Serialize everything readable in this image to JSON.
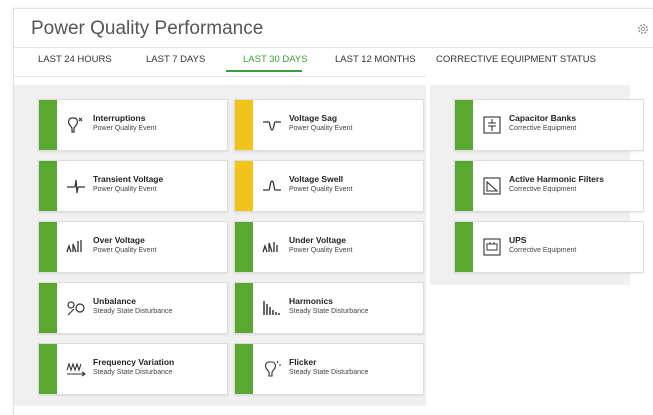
{
  "header": {
    "title": "Power Quality Performance",
    "settings_icon": "gear-icon"
  },
  "tabs": [
    {
      "label": "LAST 24 HOURS",
      "active": false
    },
    {
      "label": "LAST 7 DAYS",
      "active": false
    },
    {
      "label": "LAST 30 DAYS",
      "active": true
    },
    {
      "label": "LAST 12 MONTHS",
      "active": false
    }
  ],
  "right_tab": {
    "label": "CORRECTIVE EQUIPMENT STATUS"
  },
  "colors": {
    "green": "#5aa832",
    "yellow": "#f0c419",
    "accent": "#3d9a3d"
  },
  "events": [
    {
      "title": "Interruptions",
      "subtitle": "Power Quality Event",
      "status": "green",
      "icon": "interruption-icon"
    },
    {
      "title": "Voltage Sag",
      "subtitle": "Power Quality Event",
      "status": "yellow",
      "icon": "voltage-sag-icon"
    },
    {
      "title": "Transient Voltage",
      "subtitle": "Power Quality Event",
      "status": "green",
      "icon": "transient-icon"
    },
    {
      "title": "Voltage Swell",
      "subtitle": "Power Quality Event",
      "status": "yellow",
      "icon": "voltage-swell-icon"
    },
    {
      "title": "Over Voltage",
      "subtitle": "Power Quality Event",
      "status": "green",
      "icon": "over-voltage-icon"
    },
    {
      "title": "Under Voltage",
      "subtitle": "Power Quality Event",
      "status": "green",
      "icon": "under-voltage-icon"
    },
    {
      "title": "Unbalance",
      "subtitle": "Steady State Disturbance",
      "status": "green",
      "icon": "unbalance-icon"
    },
    {
      "title": "Harmonics",
      "subtitle": "Steady State Disturbance",
      "status": "green",
      "icon": "harmonics-icon"
    },
    {
      "title": "Frequency Variation",
      "subtitle": "Steady State Disturbance",
      "status": "green",
      "icon": "frequency-icon"
    },
    {
      "title": "Flicker",
      "subtitle": "Steady State Disturbance",
      "status": "green",
      "icon": "flicker-icon"
    }
  ],
  "equipment": [
    {
      "title": "Capacitor Banks",
      "subtitle": "Corrective Equipment",
      "status": "green",
      "icon": "capacitor-icon"
    },
    {
      "title": "Active Harmonic Filters",
      "subtitle": "Corrective Equipment",
      "status": "green",
      "icon": "filter-icon"
    },
    {
      "title": "UPS",
      "subtitle": "Corrective Equipment",
      "status": "green",
      "icon": "ups-icon"
    }
  ]
}
